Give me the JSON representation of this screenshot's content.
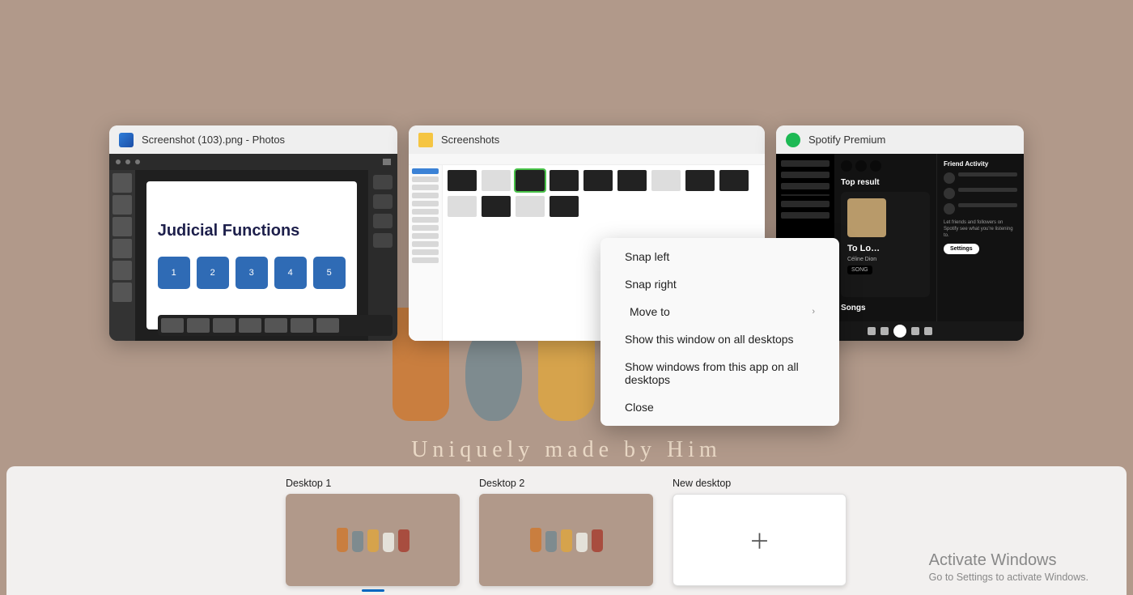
{
  "wallpaper": {
    "caption": "Uniquely made by Him"
  },
  "windows": [
    {
      "icon": "photos",
      "title": "Screenshot (103).png - Photos"
    },
    {
      "icon": "folder",
      "title": "Screenshots"
    },
    {
      "icon": "spotify",
      "title": "Spotify Premium"
    }
  ],
  "photos_slide": {
    "title": "Judicial Functions",
    "cards": [
      "1",
      "2",
      "3",
      "4",
      "5"
    ]
  },
  "spotify": {
    "top_result_label": "Top result",
    "song_title": "To Lo…",
    "artist": "Céline Dion",
    "badge": "SONG",
    "songs_label": "Songs",
    "friend_title": "Friend Activity",
    "friend_desc": "Let friends and followers on Spotify see what you're listening to.",
    "settings_btn": "Settings"
  },
  "context_menu": {
    "items": [
      {
        "label": "Snap left",
        "submenu": false
      },
      {
        "label": "Snap right",
        "submenu": false
      },
      {
        "label": "Move to",
        "submenu": true
      },
      {
        "label": "Show this window on all desktops",
        "submenu": false
      },
      {
        "label": "Show windows from this app on all desktops",
        "submenu": false
      },
      {
        "label": "Close",
        "submenu": false
      }
    ]
  },
  "desktops": {
    "tiles": [
      {
        "label": "Desktop 1",
        "active": true
      },
      {
        "label": "Desktop 2",
        "active": false
      }
    ],
    "new_label": "New desktop"
  },
  "watermark": {
    "title": "Activate Windows",
    "subtitle": "Go to Settings to activate Windows."
  }
}
